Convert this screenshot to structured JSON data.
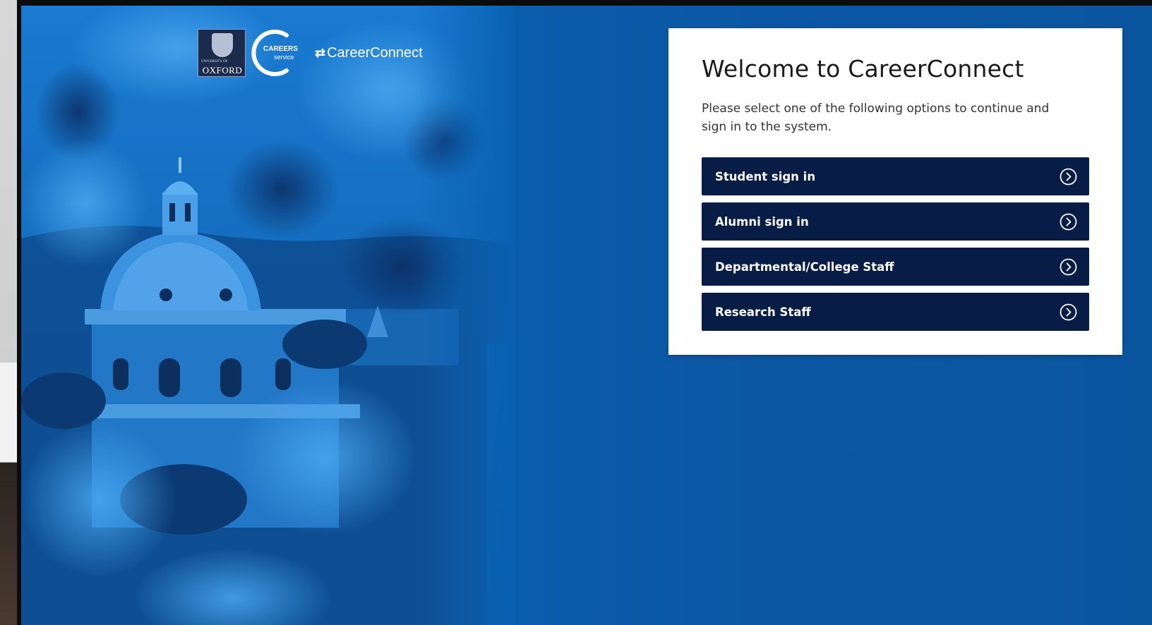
{
  "branding": {
    "oxford_small": "UNIVERSITY OF",
    "oxford": "OXFORD",
    "careers": "CAREERS",
    "service": "service",
    "careerconnect": "CareerConnect"
  },
  "card": {
    "title": "Welcome to CareerConnect",
    "description": "Please select one of the following options to continue and sign in to the system."
  },
  "options": [
    {
      "label": "Student sign in",
      "icon": "chevron-circle-right-icon"
    },
    {
      "label": "Alumni sign in",
      "icon": "chevron-circle-right-icon"
    },
    {
      "label": "Departmental/College Staff",
      "icon": "chevron-circle-right-icon"
    },
    {
      "label": "Research Staff",
      "icon": "chevron-circle-right-icon"
    }
  ],
  "colors": {
    "background_blue": "#0a5eae",
    "button_navy": "#081d45",
    "card_white": "#ffffff"
  }
}
